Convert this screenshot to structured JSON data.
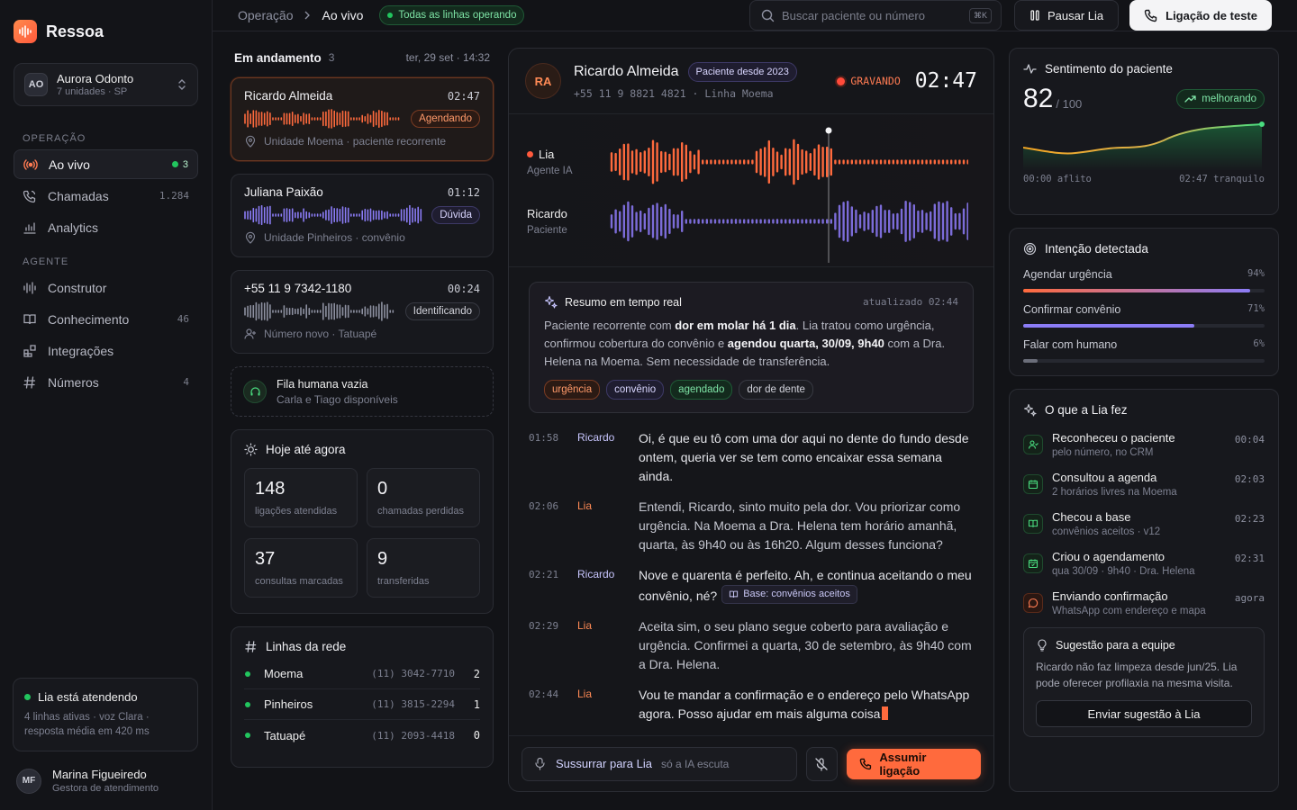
{
  "brand": {
    "name": "Ressoa"
  },
  "workspace": {
    "initials": "AO",
    "name": "Aurora Odonto",
    "sub": "7 unidades · SP"
  },
  "sidebar": {
    "section_ops": "OPERAÇÃO",
    "section_agent": "AGENTE",
    "items": [
      {
        "label": "Ao vivo",
        "count": "3"
      },
      {
        "label": "Chamadas",
        "count": "1.284"
      },
      {
        "label": "Analytics",
        "count": ""
      },
      {
        "label": "Construtor",
        "count": ""
      },
      {
        "label": "Conhecimento",
        "count": "46"
      },
      {
        "label": "Integrações",
        "count": ""
      },
      {
        "label": "Números",
        "count": "4"
      }
    ],
    "lia_status": {
      "title": "Lia está atendendo",
      "sub": "4 linhas ativas · voz Clara · resposta média em 420 ms"
    },
    "user": {
      "initials": "MF",
      "name": "Marina Figueiredo",
      "role": "Gestora de atendimento"
    }
  },
  "topbar": {
    "crumb_1": "Operação",
    "crumb_2": "Ao vivo",
    "status": "Todas as linhas operando",
    "search_placeholder": "Buscar paciente ou número",
    "search_kbd": "⌘K",
    "pause_label": "Pausar Lia",
    "test_label": "Ligação de teste"
  },
  "calls": {
    "title": "Em andamento",
    "count": "3",
    "datetime": "ter, 29 set · 14:32",
    "items": [
      {
        "name": "Ricardo Almeida",
        "time": "02:47",
        "tag": "Agendando",
        "meta": "Unidade Moema · paciente recorrente"
      },
      {
        "name": "Juliana Paixão",
        "time": "01:12",
        "tag": "Dúvida",
        "meta": "Unidade Pinheiros · convênio"
      },
      {
        "name": "+55 11 9 7342-1180",
        "time": "00:24",
        "tag": "Identificando",
        "meta": "Número novo · Tatuapé"
      }
    ],
    "queue": {
      "title": "Fila humana vazia",
      "sub": "Carla e Tiago disponíveis"
    }
  },
  "today": {
    "title": "Hoje até agora",
    "stats": [
      {
        "value": "148",
        "label": "ligações atendidas"
      },
      {
        "value": "0",
        "label": "chamadas perdidas"
      },
      {
        "value": "37",
        "label": "consultas marcadas"
      },
      {
        "value": "9",
        "label": "transferidas"
      }
    ]
  },
  "network": {
    "title": "Linhas da rede",
    "lines": [
      {
        "name": "Moema",
        "phone": "(11) 3042-7710",
        "count": "2"
      },
      {
        "name": "Pinheiros",
        "phone": "(11) 3815-2294",
        "count": "1"
      },
      {
        "name": "Tatuapé",
        "phone": "(11) 2093-4418",
        "count": "0"
      }
    ]
  },
  "active_call": {
    "initials": "RA",
    "name": "Ricardo Almeida",
    "since": "Paciente desde 2023",
    "sub": "+55 11 9 8821 4821 · Linha Moema",
    "recording": "GRAVANDO",
    "timer": "02:47",
    "speaker_1": {
      "name": "Lia",
      "role": "Agente IA"
    },
    "speaker_2": {
      "name": "Ricardo",
      "role": "Paciente"
    },
    "summary": {
      "title": "Resumo em tempo real",
      "updated": "atualizado 02:44",
      "p1": "Paciente recorrente com ",
      "b1": "dor em molar há 1 dia",
      "p2": ". Lia tratou como urgência, confirmou cobertura do convênio e ",
      "b2": "agendou quarta, 30/09, 9h40",
      "p3": " com a Dra. Helena na Moema. Sem necessidade de transferência.",
      "tags": [
        "urgência",
        "convênio",
        "agendado",
        "dor de dente"
      ]
    },
    "transcript": [
      {
        "t": "01:58",
        "who": "Ricardo",
        "text": "Oi, é que eu tô com uma dor aqui no dente do fundo desde ontem, queria ver se tem como encaixar essa semana ainda."
      },
      {
        "t": "02:06",
        "who": "Lia",
        "text": "Entendi, Ricardo, sinto muito pela dor. Vou priorizar como urgência. Na Moema a Dra. Helena tem horário amanhã, quarta, às 9h40 ou às 16h20. Algum desses funciona?"
      },
      {
        "t": "02:21",
        "who": "Ricardo",
        "text": "Nove e quarenta é perfeito. Ah, e continua aceitando o meu convênio, né?",
        "kb": "Base: convênios aceitos"
      },
      {
        "t": "02:29",
        "who": "Lia",
        "text": "Aceita sim, o seu plano segue coberto para avaliação e urgência. Confirmei a quarta, 30 de setembro, às 9h40 com a Dra. Helena."
      },
      {
        "t": "02:44",
        "who": "Lia",
        "text": "Vou te mandar a confirmação e o endereço pelo WhatsApp agora. Posso ajudar em mais alguma coisa"
      }
    ],
    "whisper_label": "Sussurrar para Lia",
    "whisper_hint": "só a IA escuta",
    "takeover_label": "Assumir ligação"
  },
  "sentiment": {
    "title": "Sentimento do paciente",
    "value": "82",
    "max": "/ 100",
    "trend": "melhorando",
    "axis_start": "00:00 aflito",
    "axis_end": "02:47 tranquilo"
  },
  "intent": {
    "title": "Intenção detectada",
    "items": [
      {
        "label": "Agendar urgência",
        "pct": "94%",
        "value": 0.94
      },
      {
        "label": "Confirmar convênio",
        "pct": "71%",
        "value": 0.71
      },
      {
        "label": "Falar com humano",
        "pct": "6%",
        "value": 0.06
      }
    ]
  },
  "actions": {
    "title": "O que a Lia fez",
    "items": [
      {
        "title": "Reconheceu o paciente",
        "sub": "pelo número, no CRM",
        "time": "00:04"
      },
      {
        "title": "Consultou a agenda",
        "sub": "2 horários livres na Moema",
        "time": "02:03"
      },
      {
        "title": "Checou a base",
        "sub": "convênios aceitos · v12",
        "time": "02:23"
      },
      {
        "title": "Criou o agendamento",
        "sub": "qua 30/09 · 9h40 · Dra. Helena",
        "time": "02:31"
      },
      {
        "title": "Enviando confirmação",
        "sub": "WhatsApp com endereço e mapa",
        "time": "agora"
      }
    ],
    "suggestion": {
      "title": "Sugestão para a equipe",
      "text": "Ricardo não faz limpeza desde jun/25. Lia pode oferecer profilaxia na mesma visita.",
      "button": "Enviar sugestão à Lia"
    }
  },
  "colors": {
    "accent": "#ff6a3d",
    "purple": "#8b7cf6",
    "green": "#22c55e"
  }
}
